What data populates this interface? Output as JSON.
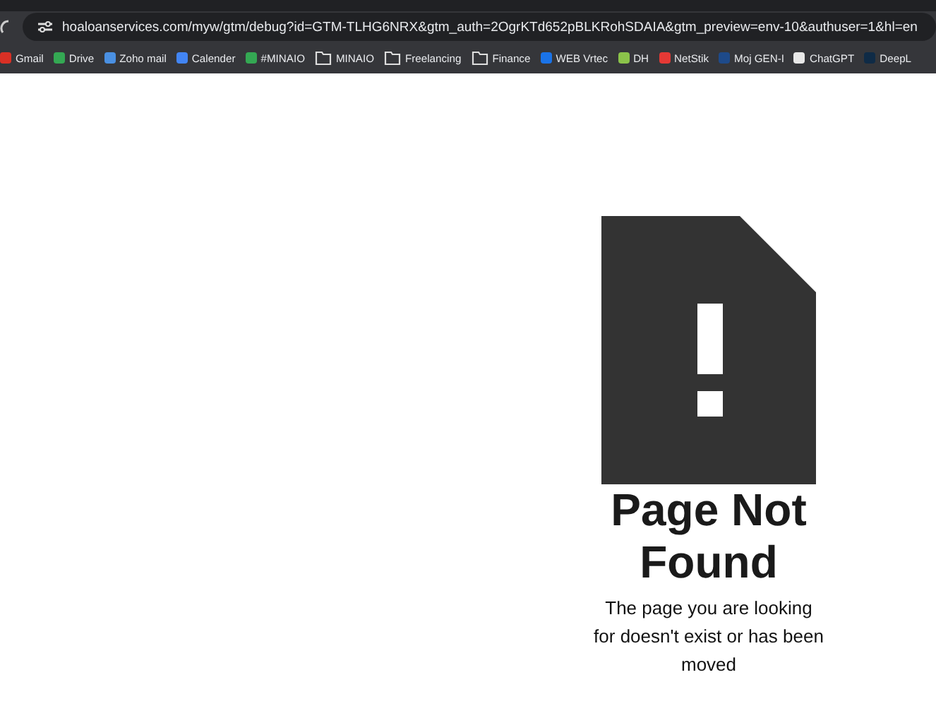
{
  "address_bar": {
    "url": "hoaloanservices.com/myw/gtm/debug?id=GTM-TLHG6NRX&gtm_auth=2OgrKTd652pBLKRohSDAIA&gtm_preview=env-10&authuser=1&hl=en"
  },
  "bookmarks": [
    {
      "label": "Gmail",
      "kind": "site",
      "color": "#d93025"
    },
    {
      "label": "Drive",
      "kind": "site",
      "color": "#34a853"
    },
    {
      "label": "Zoho mail",
      "kind": "site",
      "color": "#4a90e2"
    },
    {
      "label": "Calender",
      "kind": "site",
      "color": "#4285f4"
    },
    {
      "label": "#MINAIO",
      "kind": "site",
      "color": "#34a853"
    },
    {
      "label": "MINAIO",
      "kind": "folder"
    },
    {
      "label": "Freelancing",
      "kind": "folder"
    },
    {
      "label": "Finance",
      "kind": "folder"
    },
    {
      "label": "WEB Vrtec",
      "kind": "site",
      "color": "#1a73e8"
    },
    {
      "label": "DH",
      "kind": "site",
      "color": "#8bc34a"
    },
    {
      "label": "NetStik",
      "kind": "site",
      "color": "#e53935"
    },
    {
      "label": "Moj GEN-I",
      "kind": "site",
      "color": "#1e4a8a"
    },
    {
      "label": "ChatGPT",
      "kind": "site",
      "color": "#e8e8e8"
    },
    {
      "label": "DeepL",
      "kind": "site",
      "color": "#0f2b46"
    }
  ],
  "page": {
    "title": "Page Not Found",
    "message": "The page you are looking for doesn't exist or has been moved"
  }
}
